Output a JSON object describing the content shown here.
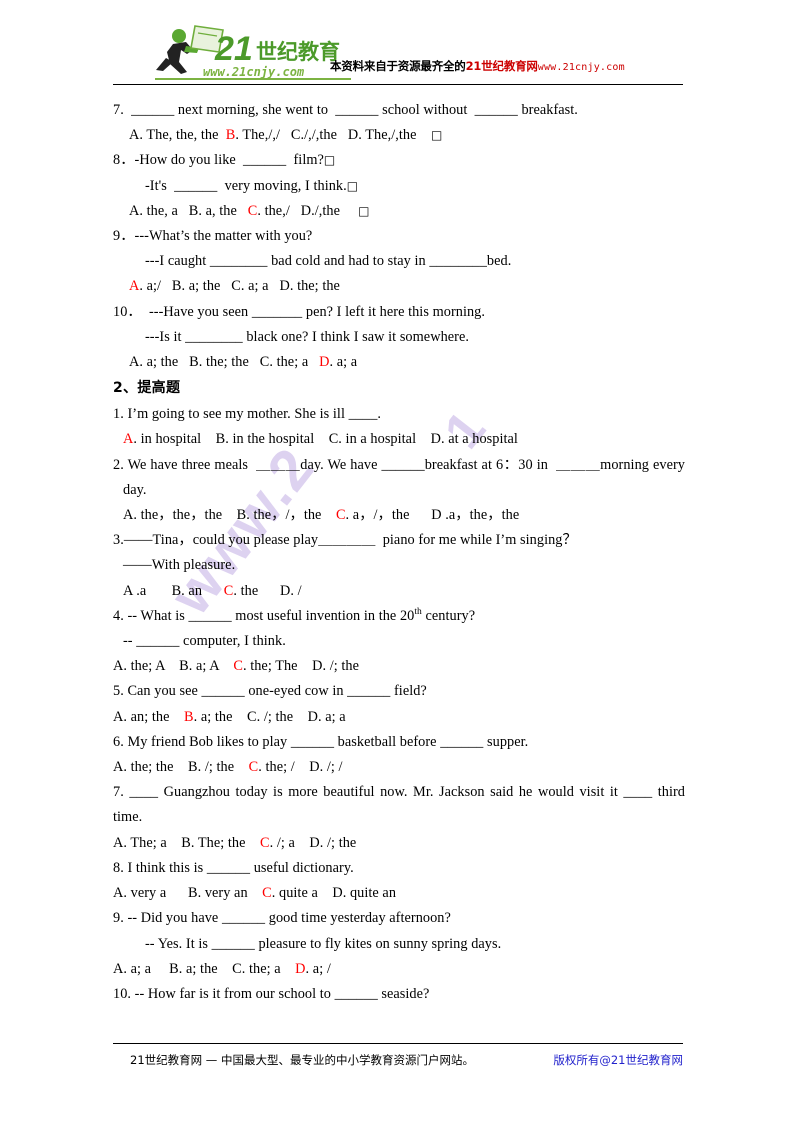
{
  "header": {
    "logo_alt": "21cnjy-logo",
    "logo_main_text": "21世纪教育",
    "logo_url_text": "www.21cnjy.com",
    "tagline_black": "本资料来自于资源最齐全的",
    "tagline_red": "21世纪教育网",
    "tagline_url": "www.21cnjy.com"
  },
  "watermark": {
    "text1": "www.2",
    "text2": "1"
  },
  "content": {
    "lines": [
      {
        "id": "q7-stem",
        "indent": 0,
        "parts": [
          {
            "t": "7.  ______ next morning, she went to  ______ school without  ______ breakfast."
          }
        ]
      },
      {
        "id": "q7-options",
        "indent": 1,
        "parts": [
          {
            "t": "A. The, the, the  "
          },
          {
            "t": "B",
            "c": "red"
          },
          {
            "t": ". The,/,/   C./,/,the   D. The,/,the    "
          },
          {
            "t": "□",
            "c": "tofu"
          }
        ]
      },
      {
        "id": "q8-stem",
        "indent": 0,
        "parts": [
          {
            "t": "8．-How do you like  ______  film?"
          },
          {
            "t": "□",
            "c": "tofu"
          }
        ]
      },
      {
        "id": "q8-stem2",
        "indent": 2,
        "parts": [
          {
            "t": "-It's  ______  very moving, I think."
          },
          {
            "t": "□",
            "c": "tofu"
          }
        ]
      },
      {
        "id": "q8-options",
        "indent": 1,
        "parts": [
          {
            "t": "A. the, a   B. a, the   "
          },
          {
            "t": "C",
            "c": "red"
          },
          {
            "t": ". the,/   D./,the     "
          },
          {
            "t": "□",
            "c": "tofu"
          }
        ]
      },
      {
        "id": "q9-stem",
        "indent": 0,
        "parts": [
          {
            "t": "9．---What’s the matter with you?"
          }
        ]
      },
      {
        "id": "q9-stem2",
        "indent": 2,
        "parts": [
          {
            "t": "---I caught ________ bad cold and had to stay in ________bed."
          }
        ]
      },
      {
        "id": "q9-options",
        "indent": 1,
        "parts": [
          {
            "t": "A",
            "c": "red"
          },
          {
            "t": ". a;/   B. a; the   C. a; a   D. the; the"
          }
        ]
      },
      {
        "id": "q10-stem",
        "indent": 0,
        "parts": [
          {
            "t": "10．  ---Have you seen _______ pen? I left it here this morning."
          }
        ]
      },
      {
        "id": "q10-stem2",
        "indent": 2,
        "parts": [
          {
            "t": "---Is it ________ black one? I think I saw it somewhere."
          }
        ]
      },
      {
        "id": "q10-options",
        "indent": 1,
        "parts": [
          {
            "t": "A. a; the   B. the; the   C. the; a   "
          },
          {
            "t": "D",
            "c": "red"
          },
          {
            "t": ". a; a"
          }
        ]
      }
    ],
    "section_heading": "2、提高题",
    "lines2": [
      {
        "id": "p1-stem",
        "indent": 0,
        "parts": [
          {
            "t": "1. I’m going to see my mother. She is ill ____."
          }
        ]
      },
      {
        "id": "p1-options",
        "indent": 4,
        "parts": [
          {
            "t": "A",
            "c": "red"
          },
          {
            "t": ". in hospital    B. in the hospital    C. in a hospital    D. at a hospital"
          }
        ]
      },
      {
        "id": "p2-stem",
        "indent": 0,
        "parts": [
          {
            "t": "2. We have three meals  ＿＿＿day. We have ______breakfast at 6：30 in  ＿＿＿morning every"
          }
        ],
        "justify": true
      },
      {
        "id": "p2-stem2",
        "indent": 4,
        "parts": [
          {
            "t": "day."
          }
        ]
      },
      {
        "id": "p2-options",
        "indent": 4,
        "parts": [
          {
            "t": "A. the，the，the    B. the，/，the    "
          },
          {
            "t": "C",
            "c": "red"
          },
          {
            "t": ". a，/，the      D .a，the，the"
          }
        ]
      },
      {
        "id": "p3-stem",
        "indent": 0,
        "parts": [
          {
            "t": "3.——Tina，could you please play＿＿＿＿  piano for me while I’m singing？"
          }
        ]
      },
      {
        "id": "p3-stem2",
        "indent": 4,
        "parts": [
          {
            "t": "——With pleasure."
          }
        ]
      },
      {
        "id": "p3-options",
        "indent": 4,
        "parts": [
          {
            "t": "A .a       B. an      "
          },
          {
            "t": "C",
            "c": "red"
          },
          {
            "t": ". the      D. /"
          }
        ]
      },
      {
        "id": "p4-stem",
        "indent": 0,
        "parts": [
          {
            "t": "4. -- What is ______ most useful invention in the 20"
          },
          {
            "t": "th",
            "sup": true
          },
          {
            "t": " century?"
          }
        ]
      },
      {
        "id": "p4-stem2",
        "indent": 4,
        "parts": [
          {
            "t": "-- ______ computer, I think."
          }
        ]
      },
      {
        "id": "p4-options",
        "indent": 0,
        "parts": [
          {
            "t": "A. the; A    B. a; A    "
          },
          {
            "t": "C",
            "c": "red"
          },
          {
            "t": ". the; The    D. /; the"
          }
        ]
      },
      {
        "id": "p5-stem",
        "indent": 0,
        "parts": [
          {
            "t": "5. Can you see ______ one-eyed cow in ______ field?"
          }
        ]
      },
      {
        "id": "p5-options",
        "indent": 0,
        "parts": [
          {
            "t": "A. an; the    "
          },
          {
            "t": "B",
            "c": "red"
          },
          {
            "t": ". a; the    C. /; the    D. a; a"
          }
        ]
      },
      {
        "id": "p6-stem",
        "indent": 0,
        "parts": [
          {
            "t": "6. My friend Bob likes to play ______ basketball before ______ supper."
          }
        ]
      },
      {
        "id": "p6-options",
        "indent": 0,
        "parts": [
          {
            "t": "A. the; the    B. /; the    "
          },
          {
            "t": "C",
            "c": "red"
          },
          {
            "t": ". the; /    D. /; /"
          }
        ]
      },
      {
        "id": "p7-stem",
        "indent": 0,
        "parts": [
          {
            "t": "7. ____ Guangzhou today is more beautiful now. Mr. Jackson said he would visit it ____ third"
          }
        ],
        "justify": true
      },
      {
        "id": "p7-stem2",
        "indent": 0,
        "parts": [
          {
            "t": "time."
          }
        ]
      },
      {
        "id": "p7-options",
        "indent": 0,
        "parts": [
          {
            "t": "A. The; a    B. The; the    "
          },
          {
            "t": "C",
            "c": "red"
          },
          {
            "t": ". /; a    D. /; the"
          }
        ]
      },
      {
        "id": "p8-stem",
        "indent": 0,
        "parts": [
          {
            "t": "8. I think this is ______ useful dictionary."
          }
        ]
      },
      {
        "id": "p8-options",
        "indent": 0,
        "parts": [
          {
            "t": "A. very a      B. very an    "
          },
          {
            "t": "C",
            "c": "red"
          },
          {
            "t": ". quite a    D. quite an"
          }
        ]
      },
      {
        "id": "p9-stem",
        "indent": 0,
        "parts": [
          {
            "t": "9. -- Did you have ______ good time yesterday afternoon?"
          }
        ]
      },
      {
        "id": "p9-stem2",
        "indent": 2,
        "parts": [
          {
            "t": "-- Yes. It is ______ pleasure to fly kites on sunny spring days."
          }
        ]
      },
      {
        "id": "p9-options",
        "indent": 0,
        "parts": [
          {
            "t": "A. a; a     B. a; the    C. the; a    "
          },
          {
            "t": "D",
            "c": "red"
          },
          {
            "t": ". a; /"
          }
        ]
      },
      {
        "id": "p10-stem",
        "indent": 0,
        "parts": [
          {
            "t": "10. -- How far is it from our school to ______ seaside?"
          }
        ]
      }
    ]
  },
  "footer": {
    "left_text": "21世纪教育网 — 中国最大型、最专业的中小学教育资源门户网站。",
    "right_text": "版权所有@21世纪教育网",
    "right_color": "#2222cc"
  }
}
